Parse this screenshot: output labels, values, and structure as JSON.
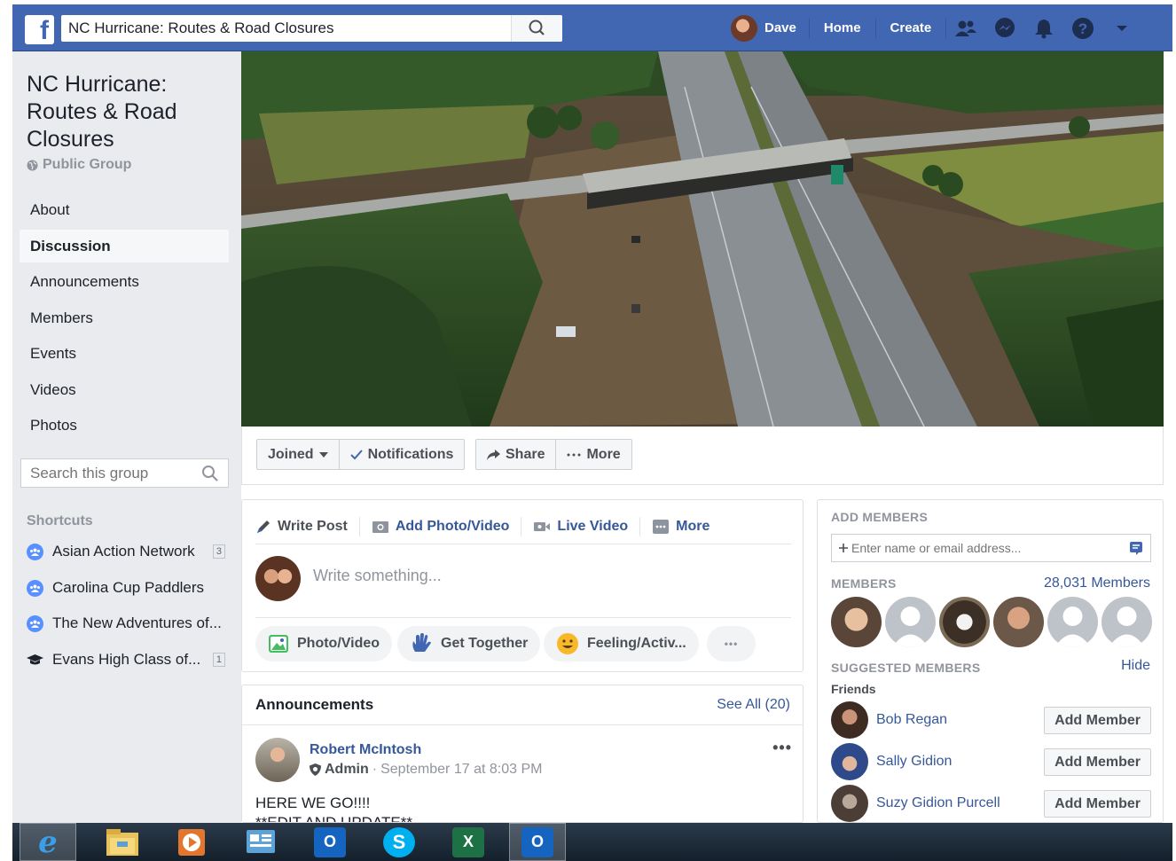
{
  "topbar": {
    "logo_letter": "f",
    "search_value": "NC Hurricane: Routes & Road Closures",
    "user_name": "Dave",
    "home_label": "Home",
    "create_label": "Create"
  },
  "group": {
    "title": "NC Hurricane: Routes & Road Closures",
    "type": "Public Group"
  },
  "leftnav": {
    "items": [
      {
        "label": "About"
      },
      {
        "label": "Discussion"
      },
      {
        "label": "Announcements"
      },
      {
        "label": "Members"
      },
      {
        "label": "Events"
      },
      {
        "label": "Videos"
      },
      {
        "label": "Photos"
      }
    ],
    "active": "Discussion",
    "search_placeholder": "Search this group"
  },
  "shortcuts": {
    "heading": "Shortcuts",
    "items": [
      {
        "label": "Asian Action Network",
        "badge": "3",
        "icon": "group-icon"
      },
      {
        "label": "Carolina Cup Paddlers",
        "badge": "",
        "icon": "group-icon"
      },
      {
        "label": "The New Adventures of...",
        "badge": "",
        "icon": "group-icon"
      },
      {
        "label": "Evans High Class of...",
        "badge": "1",
        "icon": "graduation-cap-icon"
      }
    ]
  },
  "actions": {
    "joined": "Joined",
    "notifications": "Notifications",
    "share": "Share",
    "more": "More"
  },
  "composer": {
    "tabs": {
      "write_post": "Write Post",
      "add_photo": "Add Photo/Video",
      "live_video": "Live Video",
      "more": "More"
    },
    "placeholder": "Write something...",
    "pills": {
      "photo_video": "Photo/Video",
      "get_together": "Get Together",
      "feeling": "Feeling/Activ...",
      "more_dots": "•••"
    }
  },
  "announcements": {
    "heading": "Announcements",
    "see_all": "See All (20)",
    "post": {
      "author": "Robert McIntosh",
      "role": "Admin",
      "separator": "·",
      "time": "September 17 at 8:03 PM",
      "line1": "HERE WE GO!!!!",
      "line2": "**EDIT AND UPDATE**",
      "menu": "•••"
    }
  },
  "right": {
    "add_members_heading": "ADD MEMBERS",
    "add_members_placeholder": "Enter name or email address...",
    "members_heading": "MEMBERS",
    "members_count": "28,031 Members",
    "suggested_heading": "SUGGESTED MEMBERS",
    "hide": "Hide",
    "friends_label": "Friends",
    "suggested": [
      {
        "name": "Bob Regan",
        "button": "Add Member"
      },
      {
        "name": "Sally Gidion",
        "button": "Add Member"
      },
      {
        "name": "Suzy Gidion Purcell",
        "button": "Add Member"
      }
    ]
  },
  "taskbar": {
    "apps": [
      "internet-explorer-icon",
      "file-explorer-icon",
      "media-player-icon",
      "control-panel-icon",
      "outlook-icon",
      "skype-icon",
      "excel-icon",
      "outlook-icon"
    ],
    "outlook_label": "O",
    "excel_label": "X",
    "skype_label": "S",
    "ie_label": "e"
  },
  "colors": {
    "brand_blue": "#4267b2",
    "link_blue": "#365899",
    "page_bg": "#e9ebee"
  }
}
